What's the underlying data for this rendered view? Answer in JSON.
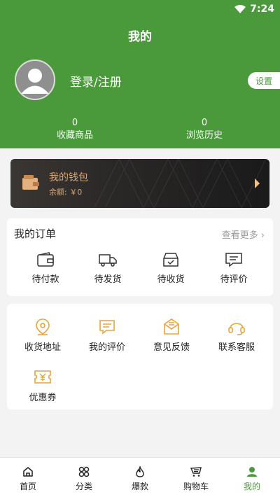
{
  "status": {
    "time": "7:24"
  },
  "header": {
    "title": "我的",
    "login_label": "登录/注册",
    "settings_label": "设置"
  },
  "stats": [
    {
      "count": "0",
      "label": "收藏商品"
    },
    {
      "count": "0",
      "label": "浏览历史"
    }
  ],
  "wallet": {
    "title": "我的钱包",
    "balance": "余额: ￥0"
  },
  "orders": {
    "title": "我的订单",
    "more": "查看更多",
    "items": [
      {
        "label": "待付款",
        "icon": "wallet-icon"
      },
      {
        "label": "待发货",
        "icon": "truck-icon"
      },
      {
        "label": "待收货",
        "icon": "inbox-icon"
      },
      {
        "label": "待评价",
        "icon": "comment-icon"
      }
    ]
  },
  "services": [
    {
      "label": "收货地址",
      "icon": "location-icon"
    },
    {
      "label": "我的评价",
      "icon": "message-icon"
    },
    {
      "label": "意见反馈",
      "icon": "mail-icon"
    },
    {
      "label": "联系客服",
      "icon": "headset-icon"
    },
    {
      "label": "优惠券",
      "icon": "coupon-icon"
    }
  ],
  "nav": [
    {
      "label": "首页",
      "icon": "home-icon"
    },
    {
      "label": "分类",
      "icon": "category-icon"
    },
    {
      "label": "爆款",
      "icon": "fire-icon"
    },
    {
      "label": "购物车",
      "icon": "cart-icon"
    },
    {
      "label": "我的",
      "icon": "user-icon"
    }
  ],
  "colors": {
    "brand": "#4a9a3b",
    "accent": "#e8a33c",
    "wallet_text": "#d8a87a"
  }
}
